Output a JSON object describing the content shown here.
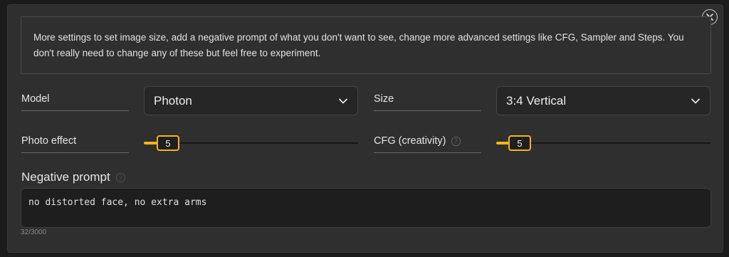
{
  "close": {
    "icon": "close-icon"
  },
  "info": {
    "text": "More settings to set image size, add a negative prompt of what you don't want to see, change more advanced settings like CFG, Sampler and Steps. You don't really need to change any of these but feel free to experiment."
  },
  "model": {
    "label": "Model",
    "value": "Photon",
    "icon": "chevron-down-icon"
  },
  "size": {
    "label": "Size",
    "value": "3:4 Vertical",
    "icon": "chevron-down-icon"
  },
  "photo_effect": {
    "label": "Photo effect",
    "value": "5"
  },
  "cfg": {
    "label": "CFG (creativity)",
    "value": "5",
    "icon": "help-icon"
  },
  "negative_prompt": {
    "label": "Negative prompt",
    "icon": "help-icon",
    "value": "no distorted face, no extra arms",
    "counter": "32/3000"
  },
  "colors": {
    "accent": "#f2b517",
    "panel": "#2f2f2f",
    "background": "#1b1b1b"
  }
}
